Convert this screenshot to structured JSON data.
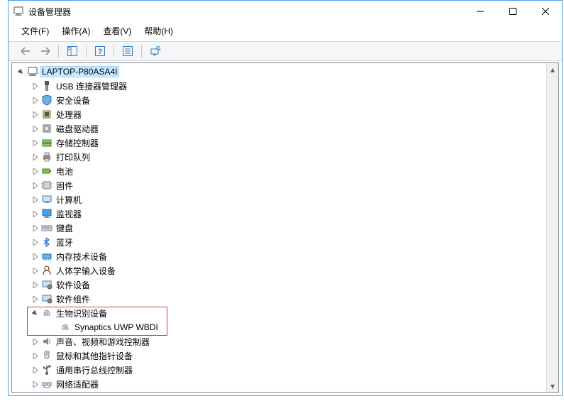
{
  "window": {
    "title": "设备管理器"
  },
  "menu": {
    "file": "文件(F)",
    "action": "操作(A)",
    "view": "查看(V)",
    "help": "帮助(H)"
  },
  "root": {
    "label": "LAPTOP-P80ASA4I"
  },
  "categories": [
    {
      "id": "usb",
      "label": "USB 连接器管理器",
      "icon": "usb-icon"
    },
    {
      "id": "security",
      "label": "安全设备",
      "icon": "shield-icon"
    },
    {
      "id": "cpu",
      "label": "处理器",
      "icon": "cpu-icon"
    },
    {
      "id": "disk",
      "label": "磁盘驱动器",
      "icon": "disk-icon"
    },
    {
      "id": "storage",
      "label": "存储控制器",
      "icon": "storage-icon"
    },
    {
      "id": "print",
      "label": "打印队列",
      "icon": "printer-icon"
    },
    {
      "id": "battery",
      "label": "电池",
      "icon": "battery-icon"
    },
    {
      "id": "firmware",
      "label": "固件",
      "icon": "chip-icon"
    },
    {
      "id": "computer",
      "label": "计算机",
      "icon": "computer-icon"
    },
    {
      "id": "monitor",
      "label": "监视器",
      "icon": "monitor-icon"
    },
    {
      "id": "keyboard",
      "label": "键盘",
      "icon": "keyboard-icon"
    },
    {
      "id": "bluetooth",
      "label": "蓝牙",
      "icon": "bluetooth-icon"
    },
    {
      "id": "memtech",
      "label": "内存技术设备",
      "icon": "memory-icon"
    },
    {
      "id": "hid",
      "label": "人体学输入设备",
      "icon": "hid-icon"
    },
    {
      "id": "softdev",
      "label": "软件设备",
      "icon": "software-icon"
    },
    {
      "id": "softcomp",
      "label": "软件组件",
      "icon": "software-icon"
    },
    {
      "id": "biometric",
      "label": "生物识别设备",
      "icon": "fingerprint-icon",
      "expanded": true,
      "children": [
        {
          "id": "wbdi",
          "label": "Synaptics UWP WBDI",
          "icon": "fingerprint-icon"
        }
      ]
    },
    {
      "id": "audio",
      "label": "声音、视频和游戏控制器",
      "icon": "speaker-icon"
    },
    {
      "id": "mouse",
      "label": "鼠标和其他指针设备",
      "icon": "mouse-icon"
    },
    {
      "id": "usbctrl",
      "label": "通用串行总线控制器",
      "icon": "usb-ctrl-icon"
    },
    {
      "id": "netadapter",
      "label": "网络适配器",
      "icon": "network-icon"
    }
  ]
}
